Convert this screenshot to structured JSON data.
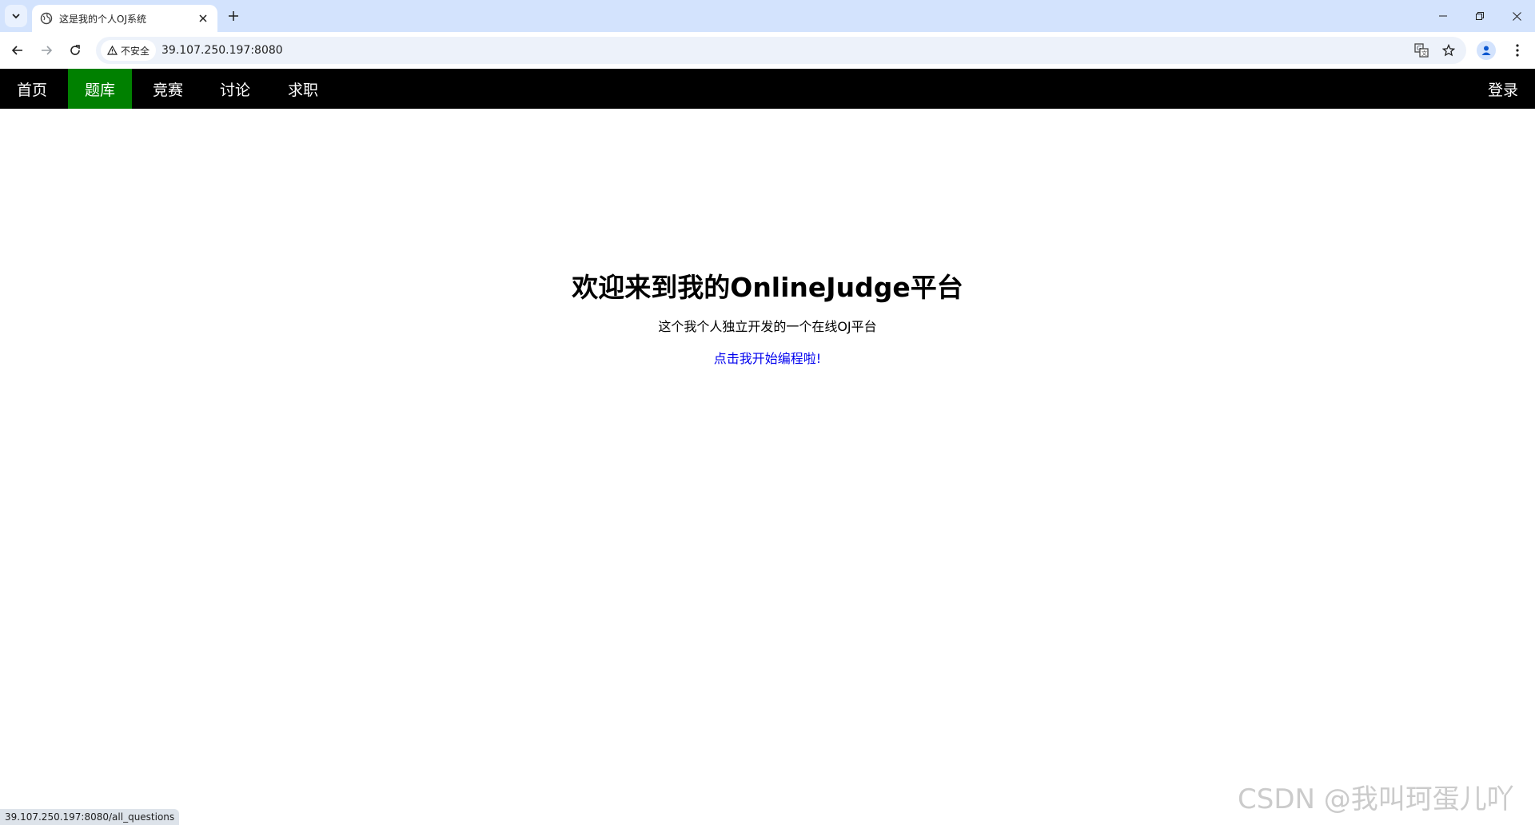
{
  "browser": {
    "tab": {
      "title": "这是我的个人OJ系统"
    },
    "address_bar": {
      "security_label": "不安全",
      "url": "39.107.250.197:8080"
    },
    "status_url": "39.107.250.197:8080/all_questions"
  },
  "navbar": {
    "items": [
      {
        "label": "首页",
        "active": false
      },
      {
        "label": "题库",
        "active": true
      },
      {
        "label": "竞赛",
        "active": false
      },
      {
        "label": "讨论",
        "active": false
      },
      {
        "label": "求职",
        "active": false
      }
    ],
    "login_label": "登录",
    "active_color": "#008000",
    "background_color": "#000000"
  },
  "hero": {
    "title": "欢迎来到我的OnlineJudge平台",
    "subtitle": "这个我个人独立开发的一个在线OJ平台",
    "link_text": "点击我开始编程啦!"
  },
  "watermark": "CSDN @我叫珂蛋儿吖",
  "icons": {
    "tab_search": "chevron-down-icon",
    "favicon": "globe-icon",
    "tab_close": "close-icon",
    "new_tab": "plus-icon",
    "back": "arrow-left-icon",
    "forward": "arrow-right-icon",
    "reload": "reload-icon",
    "security": "warning-triangle-icon",
    "translate": "translate-icon",
    "bookmark": "star-icon",
    "profile": "person-icon",
    "menu": "more-vertical-icon"
  }
}
